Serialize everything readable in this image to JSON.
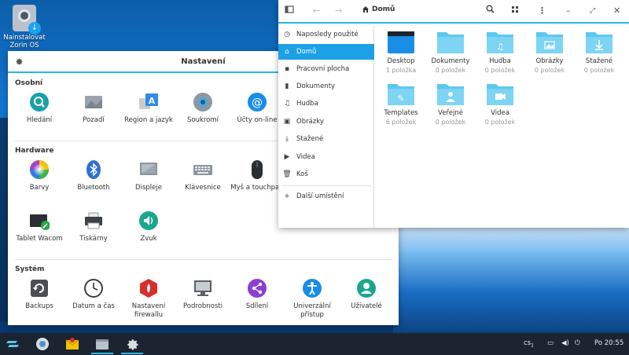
{
  "desktop": {
    "icon_label": "Nainstalovat Zorin OS"
  },
  "settings": {
    "title": "Nastavení",
    "sections": [
      {
        "title": "Osobní",
        "items": [
          {
            "label": "Hledání",
            "icon": "search-icon"
          },
          {
            "label": "Pozadí",
            "icon": "background-icon"
          },
          {
            "label": "Region a jazyk",
            "icon": "region-language-icon"
          },
          {
            "label": "Soukromí",
            "icon": "privacy-icon"
          },
          {
            "label": "Účty on-line",
            "icon": "online-accounts-icon"
          }
        ]
      },
      {
        "title": "Hardware",
        "items": [
          {
            "label": "Barvy",
            "icon": "color-icon"
          },
          {
            "label": "Bluetooth",
            "icon": "bluetooth-icon"
          },
          {
            "label": "Displeje",
            "icon": "display-icon"
          },
          {
            "label": "Klávesnice",
            "icon": "keyboard-icon"
          },
          {
            "label": "Myš a touchpad",
            "icon": "mouse-icon"
          },
          {
            "label": "Tablet Wacom",
            "icon": "tablet-icon"
          },
          {
            "label": "Tiskárny",
            "icon": "printer-icon"
          },
          {
            "label": "Zvuk",
            "icon": "sound-icon"
          }
        ]
      },
      {
        "title": "Systém",
        "items": [
          {
            "label": "Backups",
            "icon": "backups-icon"
          },
          {
            "label": "Datum a čas",
            "icon": "clock-icon"
          },
          {
            "label": "Nastavení firewallu",
            "icon": "firewall-icon"
          },
          {
            "label": "Podrobnosti",
            "icon": "details-icon"
          },
          {
            "label": "Sdílení",
            "icon": "sharing-icon"
          },
          {
            "label": "Univerzální přístup",
            "icon": "accessibility-icon"
          },
          {
            "label": "Uživatelé",
            "icon": "users-icon"
          }
        ]
      }
    ]
  },
  "files": {
    "location": "Domů",
    "sidebar": [
      {
        "label": "Naposledy použité",
        "icon": "recent-icon"
      },
      {
        "label": "Domů",
        "icon": "home-icon",
        "active": true
      },
      {
        "label": "Pracovní plocha",
        "icon": "desktop-icon"
      },
      {
        "label": "Dokumenty",
        "icon": "document-icon"
      },
      {
        "label": "Hudba",
        "icon": "music-icon"
      },
      {
        "label": "Obrázky",
        "icon": "pictures-icon"
      },
      {
        "label": "Stažené",
        "icon": "downloads-icon"
      },
      {
        "label": "Videa",
        "icon": "videos-icon"
      },
      {
        "label": "Koš",
        "icon": "trash-icon"
      },
      {
        "label": "Další umístění",
        "icon": "plus-icon"
      }
    ],
    "folders": [
      {
        "name": "Desktop",
        "count": "1 položka"
      },
      {
        "name": "Dokumenty",
        "count": "0 položek"
      },
      {
        "name": "Hudba",
        "count": "0 položek"
      },
      {
        "name": "Obrázky",
        "count": "0 položek"
      },
      {
        "name": "Stažené",
        "count": "0 položek"
      },
      {
        "name": "Templates",
        "count": "6 položek"
      },
      {
        "name": "Veřejné",
        "count": "0 položek"
      },
      {
        "name": "Videa",
        "count": "0 položek"
      }
    ]
  },
  "taskbar": {
    "keyboard_layout": "cs",
    "keyboard_layout_sub": "1",
    "clock": "Po 20:55"
  },
  "colors": {
    "accent": "#26b8e0",
    "folder": "#5cc8ef",
    "taskbar": "#1b2430"
  }
}
